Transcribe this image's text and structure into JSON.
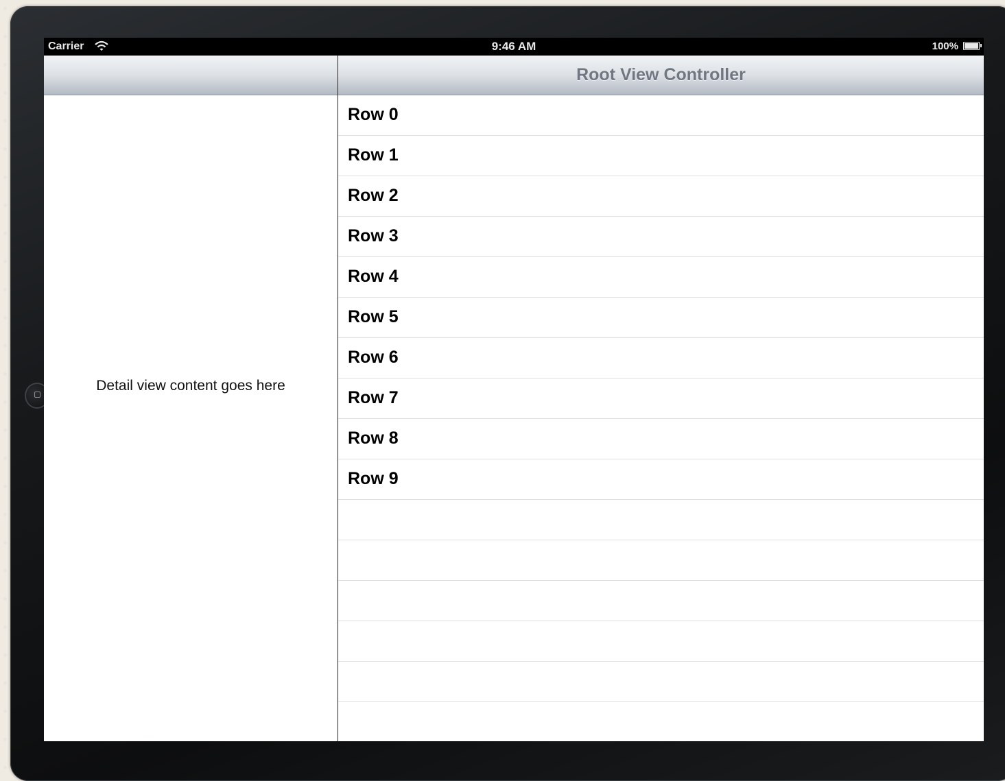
{
  "status_bar": {
    "carrier": "Carrier",
    "time": "9:46 AM",
    "battery": "100%"
  },
  "detail": {
    "text": "Detail view content goes here"
  },
  "master": {
    "title": "Root View Controller",
    "rows": [
      "Row 0",
      "Row 1",
      "Row 2",
      "Row 3",
      "Row 4",
      "Row 5",
      "Row 6",
      "Row 7",
      "Row 8",
      "Row 9"
    ],
    "empty_rows": 6
  }
}
